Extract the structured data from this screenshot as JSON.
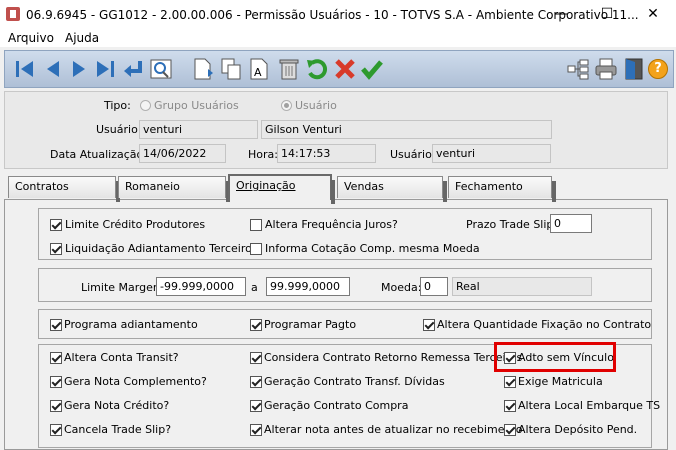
{
  "window": {
    "title": "06.9.6945 - GG1012 - 2.00.00.006 - Permissão Usuários - 10 - TOTVS S.A - Ambiente Corporativo 11...",
    "minimize_glyph": "—",
    "maximize_glyph": "☐",
    "close_glyph": "✕"
  },
  "menu": {
    "items": [
      "Arquivo",
      "Ajuda"
    ]
  },
  "toolbar": {
    "icons": [
      "first-record-icon",
      "previous-record-icon",
      "next-record-icon",
      "last-record-icon",
      "enter-icon",
      "search-record-icon",
      "new-record-icon",
      "copy-record-icon",
      "edit-record-icon",
      "delete-record-icon",
      "undo-icon",
      "cancel-icon",
      "confirm-icon",
      "tree-icon",
      "print-icon",
      "exit-icon",
      "help-icon"
    ],
    "help_glyph": "?"
  },
  "header": {
    "tipo_label": "Tipo:",
    "tipo_options": [
      "Grupo Usuários",
      "Usuário"
    ],
    "tipo_selected": "Usuário",
    "usuario_label": "Usuário:",
    "usuario_code": "venturi",
    "usuario_name": "Gilson Venturi",
    "data_label": "Data Atualização:",
    "data_value": "14/06/2022",
    "hora_label": "Hora:",
    "hora_value": "14:17:53",
    "usuario2_label": "Usuário:",
    "usuario2_value": "venturi"
  },
  "tabs": [
    "Contratos",
    "Romaneio",
    "Originação",
    "Vendas",
    "Fechamento"
  ],
  "active_tab": "Originação",
  "group1": {
    "items": [
      {
        "label": "Limite Crédito Produtores",
        "checked": true
      },
      {
        "label": "Altera Frequência Juros?",
        "checked": false
      },
      {
        "label": "Liquidação Adiantamento Terceiros",
        "checked": true
      },
      {
        "label": "Informa Cotação Comp. mesma Moeda",
        "checked": false
      }
    ],
    "prazo_label": "Prazo Trade Slip:",
    "prazo_value": "0"
  },
  "group2": {
    "limite_label": "Limite Margem:",
    "limite_from": "-99.999,0000",
    "a_label": "a",
    "limite_to": "99.999,0000",
    "moeda_label": "Moeda:",
    "moeda_code": "0",
    "moeda_name": "Real"
  },
  "group3": {
    "items": [
      {
        "label": "Programa adiantamento",
        "checked": true
      },
      {
        "label": "Programar Pagto",
        "checked": true
      },
      {
        "label": "Altera Quantidade Fixação no Contrato",
        "checked": true
      }
    ]
  },
  "group4": {
    "items": [
      {
        "label": "Altera Conta Transit?",
        "checked": true
      },
      {
        "label": "Considera Contrato Retorno Remessa Terceiros",
        "checked": true
      },
      {
        "label": "Adto sem Vínculo",
        "checked": true
      },
      {
        "label": "Gera Nota Complemento?",
        "checked": true
      },
      {
        "label": "Geração Contrato Transf. Dívidas",
        "checked": true
      },
      {
        "label": "Exige Matricula",
        "checked": true
      },
      {
        "label": "Gera Nota Crédito?",
        "checked": true
      },
      {
        "label": "Geração Contrato Compra",
        "checked": true
      },
      {
        "label": "Altera Local Embarque TS",
        "checked": true
      },
      {
        "label": "Cancela Trade Slip?",
        "checked": true
      },
      {
        "label": "Alterar nota antes de atualizar no recebimento",
        "checked": true
      },
      {
        "label": "Altera Depósito Pend.",
        "checked": true
      }
    ]
  },
  "colors": {
    "highlight": "#e00000",
    "toolbar_blue": "#2d6fb8",
    "undo_green": "#2e9a2e",
    "cancel_red": "#d83a2a"
  }
}
